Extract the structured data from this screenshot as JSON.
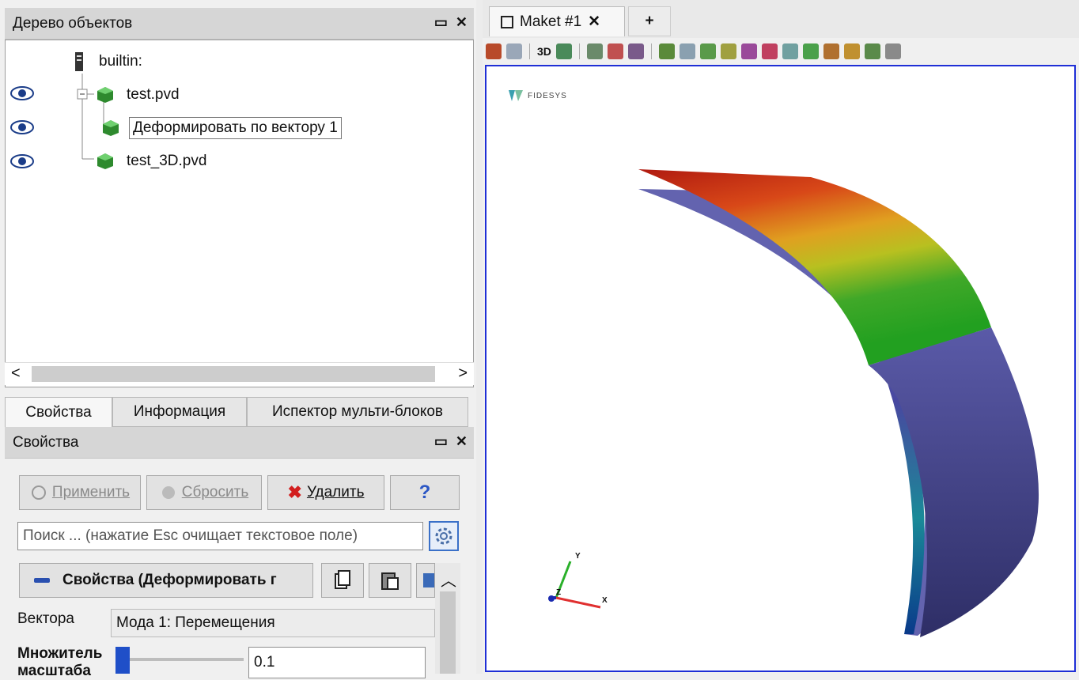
{
  "object_tree": {
    "title": "Дерево объектов",
    "items": [
      {
        "label": "builtin:"
      },
      {
        "label": "test.pvd"
      },
      {
        "label": "Деформировать по вектору 1"
      },
      {
        "label": "test_3D.pvd"
      }
    ]
  },
  "bottom_tabs": [
    "Свойства",
    "Информация",
    "Испектор мульти-блоков"
  ],
  "properties": {
    "title": "Свойства",
    "apply_label": "Применить",
    "reset_label": "Сбросить",
    "delete_label": "Удалить",
    "help_label": "?",
    "search_placeholder": "Поиск ... (нажатие Esc очищает текстовое поле)",
    "section_label": "Свойства (Деформировать г",
    "vectors_label": "Вектора",
    "vectors_value": "Мода 1: Перемещения",
    "scale_label_line1": "Множитель",
    "scale_label_line2": "масштаба",
    "scale_value": "0.1"
  },
  "view": {
    "tab_label": "Maket #1",
    "close_glyph": "✕",
    "add_tab_glyph": "+",
    "toolbar_3d": "3D",
    "logo_text": "FIDESYS",
    "axis_x": "X",
    "axis_y": "Y",
    "axis_z": "Z"
  },
  "colors": {
    "accent_blue": "#1f2fd6",
    "result_red": "#b01a10",
    "result_green": "#22a020",
    "mesh_purple": "#5a5aa8"
  }
}
